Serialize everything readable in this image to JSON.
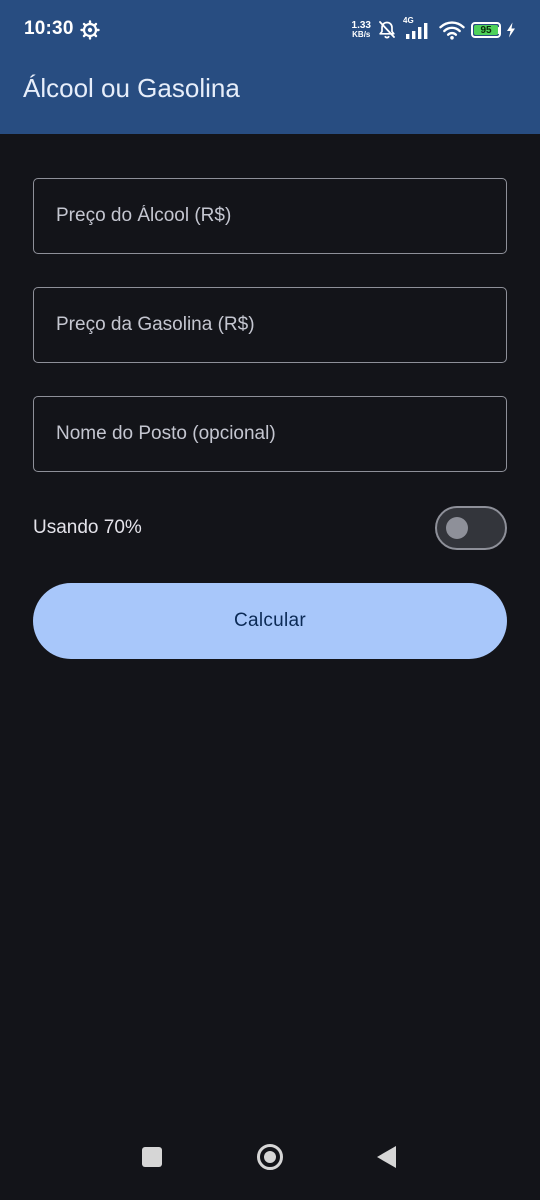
{
  "status_bar": {
    "time": "10:30",
    "net_speed_value": "1.33",
    "net_speed_unit": "KB/s",
    "network_type": "4G",
    "battery_level": "95",
    "icons": [
      "settings-gear-icon",
      "notifications-off-icon",
      "signal-icon",
      "wifi-icon",
      "battery-icon",
      "charging-bolt-icon"
    ]
  },
  "app_bar": {
    "title": "Álcool ou Gasolina"
  },
  "form": {
    "alcohol_price": {
      "placeholder": "Preço do Álcool (R$)",
      "value": ""
    },
    "gasoline_price": {
      "placeholder": "Preço da Gasolina (R$)",
      "value": ""
    },
    "station_name": {
      "placeholder": "Nome do Posto (opcional)",
      "value": ""
    },
    "ratio_toggle": {
      "label": "Usando 70%",
      "checked": false
    },
    "calculate_label": "Calcular"
  },
  "nav_bar": {
    "icons": [
      "recents-icon",
      "home-icon",
      "back-icon"
    ]
  },
  "colors": {
    "app_bar": "#284d81",
    "background": "#131419",
    "button": "#a8c7fa",
    "button_text": "#0b2a55",
    "outline": "#8e9099"
  }
}
